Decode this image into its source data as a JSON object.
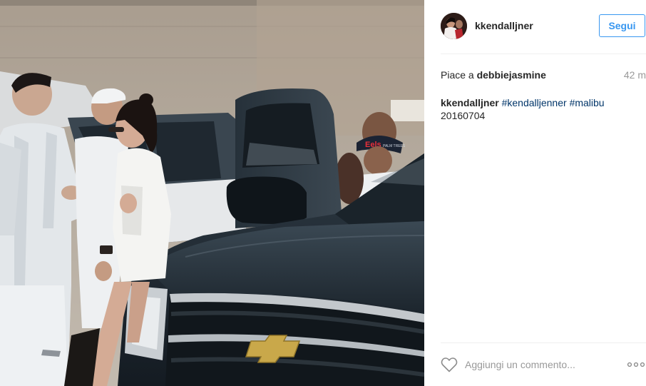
{
  "post": {
    "username": "kkendalljner",
    "follow_label": "Segui",
    "likes_prefix": "Piace a",
    "likes_user": "debbiejasmine",
    "time_ago": "42 m",
    "caption": {
      "user": "kkendalljner",
      "tags": [
        "#kendalljenner",
        "#malibu"
      ],
      "date_text": "20160704"
    },
    "comment_placeholder": "Aggiungi un commento...",
    "icons": {
      "like": "heart-icon",
      "more": "more-options-icon",
      "avatar": "avatar"
    },
    "photo": {
      "cap_text": "Eels",
      "cap_text_small": "PALM TREES"
    },
    "colors": {
      "follow_blue": "#3897f0",
      "hashtag": "#003569",
      "meta_gray": "#999999",
      "divider": "#efefef"
    }
  }
}
